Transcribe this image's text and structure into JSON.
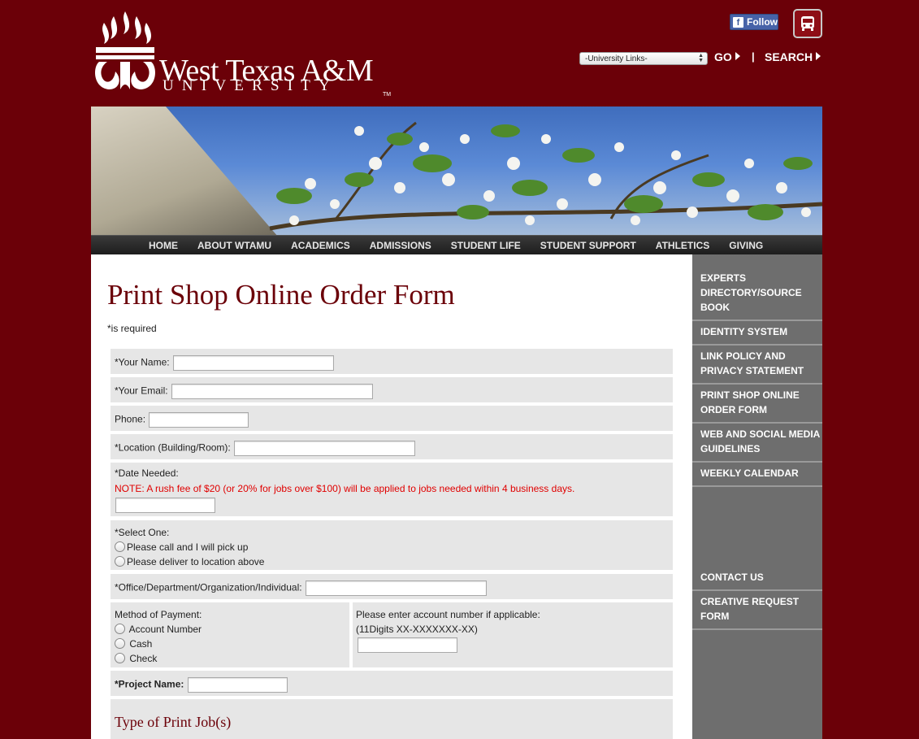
{
  "header": {
    "logo_title": "West Texas A&M",
    "logo_sub": "UNIVERSITY",
    "logo_tm": "TM",
    "facebook_label": "Follow",
    "university_links_select": "-University Links-",
    "go_label": "GO",
    "separator": "|",
    "search_label": "SEARCH"
  },
  "nav": [
    "HOME",
    "ABOUT WTAMU",
    "ACADEMICS",
    "ADMISSIONS",
    "STUDENT LIFE",
    "STUDENT SUPPORT",
    "ATHLETICS",
    "GIVING"
  ],
  "page": {
    "title": "Print Shop Online Order Form",
    "required_note": "*is required"
  },
  "form": {
    "name_label": "*Your Name:",
    "email_label": "*Your Email:",
    "phone_label": "Phone:",
    "location_label": "*Location (Building/Room):",
    "date_label": "*Date Needed:",
    "date_note": "NOTE: A rush fee of $20 (or 20% for jobs over $100) will be applied to jobs needed within 4 business days.",
    "select_one_label": "*Select One:",
    "delivery_options": [
      "Please call and I will pick up",
      "Please deliver to location above"
    ],
    "office_label": "*Office/Department/Organization/Individual:",
    "payment_label": "Method of Payment:",
    "payment_options": [
      "Account Number",
      "Cash",
      "Check"
    ],
    "account_label": "Please enter account number if applicable:",
    "account_hint": "(11Digits XX-XXXXXXX-XX)",
    "project_label": "*Project Name:",
    "print_job_heading": "Type of Print Job(s)"
  },
  "sidebar": {
    "items": [
      "EXPERTS DIRECTORY/SOURCE BOOK",
      "IDENTITY SYSTEM",
      "LINK POLICY AND PRIVACY STATEMENT",
      "PRINT SHOP ONLINE ORDER FORM",
      "WEB AND SOCIAL MEDIA GUIDELINES",
      "WEEKLY CALENDAR"
    ],
    "bottom_items": [
      "CONTACT US",
      "CREATIVE REQUEST FORM"
    ]
  },
  "colors": {
    "background": "#6b0008",
    "title": "#6b0008",
    "note_red": "#e00000",
    "form_row": "#e6e6e6",
    "sidebar": "#6e6e6e",
    "navbar": "#2a2a2a"
  },
  "icons": {
    "logo": "wtamu-flame-logo",
    "facebook": "facebook-icon",
    "bus": "bus-icon",
    "go": "triangle-right-icon",
    "search": "triangle-right-icon"
  }
}
